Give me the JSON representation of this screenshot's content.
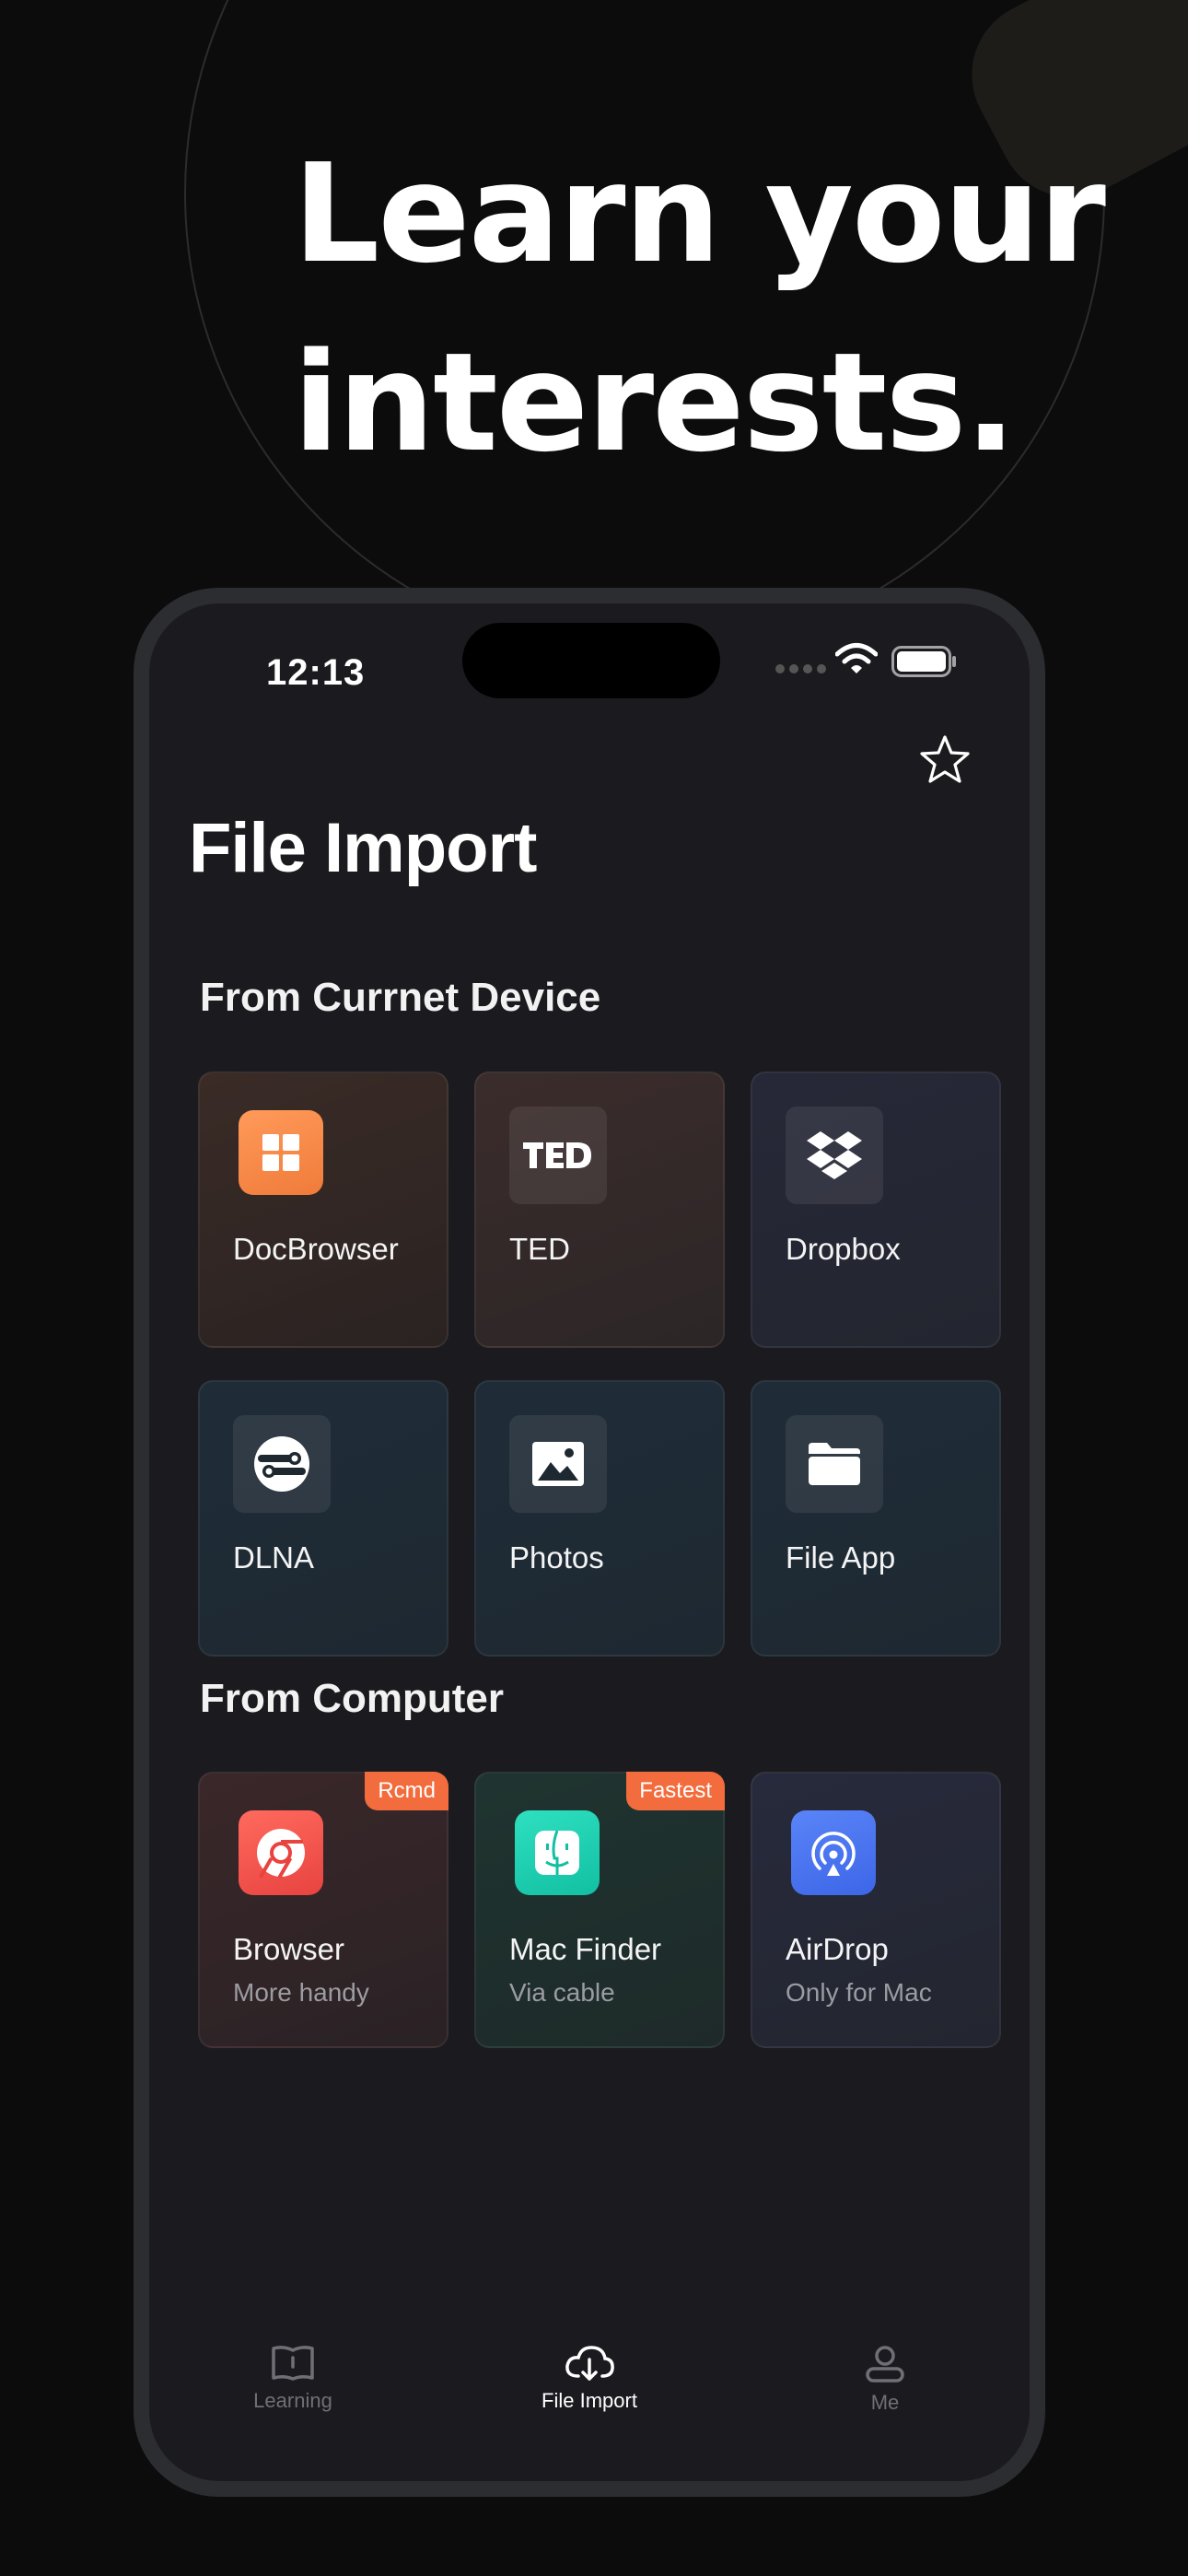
{
  "headline": {
    "line1": "Learn your",
    "line2": "interests."
  },
  "status_bar": {
    "time": "12:13"
  },
  "header": {
    "favorite_icon": "star-outline-icon",
    "title": "File Import"
  },
  "sections": {
    "device": {
      "title": "From Currnet Device",
      "items": [
        {
          "label": "DocBrowser",
          "icon": "grid-icon",
          "accent": "#f58a4b"
        },
        {
          "label": "TED",
          "icon": "ted-logo-icon"
        },
        {
          "label": "Dropbox",
          "icon": "dropbox-icon"
        },
        {
          "label": "DLNA",
          "icon": "dlna-icon"
        },
        {
          "label": "Photos",
          "icon": "photo-icon"
        },
        {
          "label": "File App",
          "icon": "folder-icon"
        }
      ]
    },
    "computer": {
      "title": "From Computer",
      "items": [
        {
          "label": "Browser",
          "sub": "More handy",
          "badge": "Rcmd",
          "icon": "chrome-icon",
          "accent": "#ef4f4b"
        },
        {
          "label": "Mac Finder",
          "sub": "Via cable",
          "badge": "Fastest",
          "icon": "finder-icon",
          "accent": "#1bcfb0"
        },
        {
          "label": "AirDrop",
          "sub": "Only for Mac",
          "icon": "airdrop-icon",
          "accent": "#4f78f0"
        }
      ]
    }
  },
  "badge_color": "#f36c3d",
  "tabbar": {
    "tabs": [
      {
        "label": "Learning",
        "icon": "book-icon",
        "active": false
      },
      {
        "label": "File Import",
        "icon": "cloud-download-icon",
        "active": true
      },
      {
        "label": "Me",
        "icon": "person-icon",
        "active": false
      }
    ]
  }
}
